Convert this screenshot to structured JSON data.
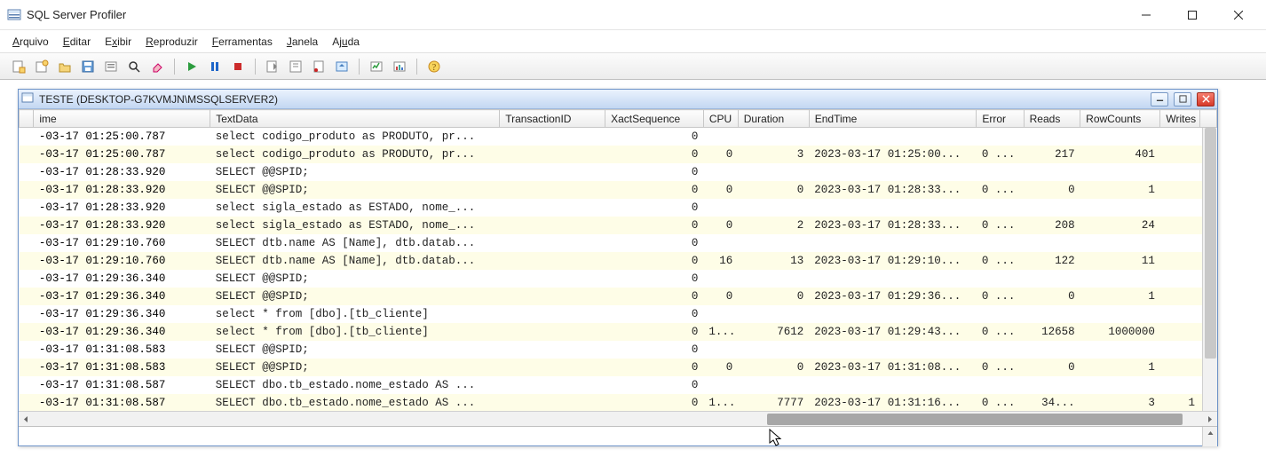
{
  "app_title": "SQL Server Profiler",
  "menus": {
    "arquivo": "Arquivo",
    "editar": "Editar",
    "exibir": "Exibir",
    "reproduzir": "Reproduzir",
    "ferramentas": "Ferramentas",
    "janela": "Janela",
    "ajuda": "Ajuda"
  },
  "child_title": "TESTE (DESKTOP-G7KVMJN\\MSSQLSERVER2)",
  "columns": {
    "ime": "ime",
    "textdata": "TextData",
    "transactionid": "TransactionID",
    "xactseq": "XactSequence",
    "cpu": "CPU",
    "duration": "Duration",
    "endtime": "EndTime",
    "error": "Error",
    "reads": "Reads",
    "rowcounts": "RowCounts",
    "writes": "Writes"
  },
  "rows": [
    {
      "ime": "-03-17 01:25:00.787",
      "textdata": "select codigo_produto as PRODUTO, pr...",
      "xactseq": "0"
    },
    {
      "ime": "-03-17 01:25:00.787",
      "textdata": "select codigo_produto as PRODUTO, pr...",
      "xactseq": "0",
      "cpu": "0",
      "duration": "3",
      "endtime": "2023-03-17 01:25:00...",
      "error": "0 ...",
      "reads": "217",
      "rowcounts": "401"
    },
    {
      "ime": "-03-17 01:28:33.920",
      "textdata": "SELECT @@SPID;",
      "xactseq": "0"
    },
    {
      "ime": "-03-17 01:28:33.920",
      "textdata": "SELECT @@SPID;",
      "xactseq": "0",
      "cpu": "0",
      "duration": "0",
      "endtime": "2023-03-17 01:28:33...",
      "error": "0 ...",
      "reads": "0",
      "rowcounts": "1"
    },
    {
      "ime": "-03-17 01:28:33.920",
      "textdata": "select sigla_estado as ESTADO, nome_...",
      "xactseq": "0"
    },
    {
      "ime": "-03-17 01:28:33.920",
      "textdata": "select sigla_estado as ESTADO, nome_...",
      "xactseq": "0",
      "cpu": "0",
      "duration": "2",
      "endtime": "2023-03-17 01:28:33...",
      "error": "0 ...",
      "reads": "208",
      "rowcounts": "24"
    },
    {
      "ime": "-03-17 01:29:10.760",
      "textdata": "SELECT dtb.name AS [Name], dtb.datab...",
      "xactseq": "0"
    },
    {
      "ime": "-03-17 01:29:10.760",
      "textdata": "SELECT dtb.name AS [Name], dtb.datab...",
      "xactseq": "0",
      "cpu": "16",
      "duration": "13",
      "endtime": "2023-03-17 01:29:10...",
      "error": "0 ...",
      "reads": "122",
      "rowcounts": "11"
    },
    {
      "ime": "-03-17 01:29:36.340",
      "textdata": "SELECT @@SPID;",
      "xactseq": "0"
    },
    {
      "ime": "-03-17 01:29:36.340",
      "textdata": "SELECT @@SPID;",
      "xactseq": "0",
      "cpu": "0",
      "duration": "0",
      "endtime": "2023-03-17 01:29:36...",
      "error": "0 ...",
      "reads": "0",
      "rowcounts": "1"
    },
    {
      "ime": "-03-17 01:29:36.340",
      "textdata": "select * from [dbo].[tb_cliente]",
      "xactseq": "0"
    },
    {
      "ime": "-03-17 01:29:36.340",
      "textdata": "select * from [dbo].[tb_cliente]",
      "xactseq": "0",
      "cpu": "1...",
      "duration": "7612",
      "endtime": "2023-03-17 01:29:43...",
      "error": "0 ...",
      "reads": "12658",
      "rowcounts": "1000000"
    },
    {
      "ime": "-03-17 01:31:08.583",
      "textdata": "SELECT @@SPID;",
      "xactseq": "0"
    },
    {
      "ime": "-03-17 01:31:08.583",
      "textdata": "SELECT @@SPID;",
      "xactseq": "0",
      "cpu": "0",
      "duration": "0",
      "endtime": "2023-03-17 01:31:08...",
      "error": "0 ...",
      "reads": "0",
      "rowcounts": "1"
    },
    {
      "ime": "-03-17 01:31:08.587",
      "textdata": "SELECT dbo.tb_estado.nome_estado AS ...",
      "xactseq": "0"
    },
    {
      "ime": "-03-17 01:31:08.587",
      "textdata": "SELECT dbo.tb_estado.nome_estado AS ...",
      "xactseq": "0",
      "cpu": "1...",
      "duration": "7777",
      "endtime": "2023-03-17 01:31:16...",
      "error": "0 ...",
      "reads": "34...",
      "rowcounts": "3",
      "writes": "1"
    }
  ]
}
